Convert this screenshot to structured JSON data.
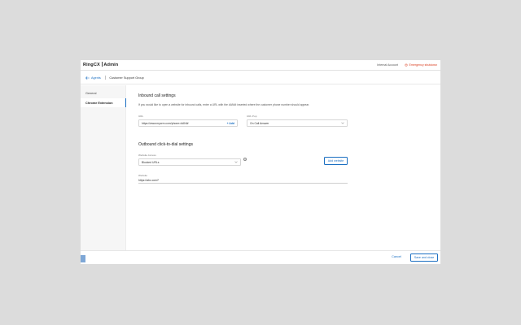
{
  "header": {
    "brand": "RingCX",
    "product": "Admin",
    "account": "Internal Account",
    "emergency_label": "Emergency shutdown"
  },
  "breadcrumb": {
    "back_label": "Agents",
    "current": "Customer Support Group"
  },
  "sidebar": {
    "items": [
      {
        "label": "General",
        "active": false
      },
      {
        "label": "Chrome Extension",
        "active": true
      }
    ]
  },
  "inbound": {
    "title": "Inbound call settings",
    "description": "If you would like to open a website for inbound calls, enter a URL with the #ANI# inserted where the customer phone number should appear.",
    "url_label": "URL",
    "url_value": "https://www.mycrm.com/phone=#ANI#",
    "url_add": "+ Add",
    "pop_label": "URL Pop",
    "pop_value": "On Call Answer"
  },
  "outbound": {
    "title": "Outbound click-to-dial settings",
    "access_label": "Website Access",
    "access_value": "Blocked URLs",
    "add_website": "Add website",
    "website_label": "Website",
    "website_value": "https://abc.com/*"
  },
  "footer": {
    "cancel": "Cancel",
    "save": "Save and close"
  },
  "colors": {
    "accent": "#1b6fc2",
    "danger": "#d93a1b"
  }
}
